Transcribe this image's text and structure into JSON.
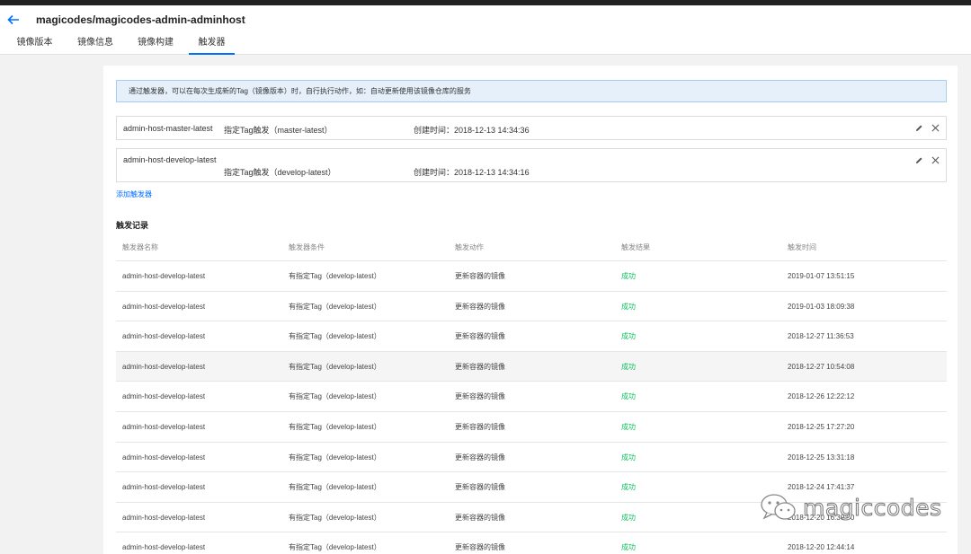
{
  "header": {
    "title": "magicodes/magicodes-admin-adminhost",
    "tabs": [
      {
        "label": "镜像版本"
      },
      {
        "label": "镜像信息"
      },
      {
        "label": "镜像构建"
      },
      {
        "label": "触发器",
        "active": true
      }
    ]
  },
  "notice": "通过触发器，可以在每次生成新的Tag（镜像版本）时，自行执行动作，如：自动更新使用该镜像仓库的服务",
  "triggers": [
    {
      "name": "admin-host-master-latest",
      "condition": "指定Tag触发（master-latest）",
      "created": "创建时间：2018-12-13 14:34:36"
    },
    {
      "name": "admin-host-develop-latest",
      "condition": "指定Tag触发（develop-latest）",
      "created": "创建时间：2018-12-13 14:34:16"
    }
  ],
  "add_trigger_label": "添加触发器",
  "records": {
    "title": "触发记录",
    "columns": [
      "触发器名称",
      "触发器条件",
      "触发动作",
      "触发结果",
      "触发时间"
    ],
    "rows": [
      [
        "admin-host-develop-latest",
        "有指定Tag（develop-latest）",
        "更新容器的镜像",
        "成功",
        "2019-01-07 13:51:15"
      ],
      [
        "admin-host-develop-latest",
        "有指定Tag（develop-latest）",
        "更新容器的镜像",
        "成功",
        "2019-01-03 18:09:38"
      ],
      [
        "admin-host-develop-latest",
        "有指定Tag（develop-latest）",
        "更新容器的镜像",
        "成功",
        "2018-12-27 11:36:53"
      ],
      [
        "admin-host-develop-latest",
        "有指定Tag（develop-latest）",
        "更新容器的镜像",
        "成功",
        "2018-12-27 10:54:08"
      ],
      [
        "admin-host-develop-latest",
        "有指定Tag（develop-latest）",
        "更新容器的镜像",
        "成功",
        "2018-12-26 12:22:12"
      ],
      [
        "admin-host-develop-latest",
        "有指定Tag（develop-latest）",
        "更新容器的镜像",
        "成功",
        "2018-12-25 17:27:20"
      ],
      [
        "admin-host-develop-latest",
        "有指定Tag（develop-latest）",
        "更新容器的镜像",
        "成功",
        "2018-12-25 13:31:18"
      ],
      [
        "admin-host-develop-latest",
        "有指定Tag（develop-latest）",
        "更新容器的镜像",
        "成功",
        "2018-12-24 17:41:37"
      ],
      [
        "admin-host-develop-latest",
        "有指定Tag（develop-latest）",
        "更新容器的镜像",
        "成功",
        "2018-12-20 16:30:00"
      ],
      [
        "admin-host-develop-latest",
        "有指定Tag（develop-latest）",
        "更新容器的镜像",
        "成功",
        "2018-12-20 12:44:14"
      ]
    ]
  },
  "watermark": "magiccodes",
  "colors": {
    "accent": "#006eff",
    "success": "#0abf5b",
    "notice_bg": "#e5f0fb"
  }
}
